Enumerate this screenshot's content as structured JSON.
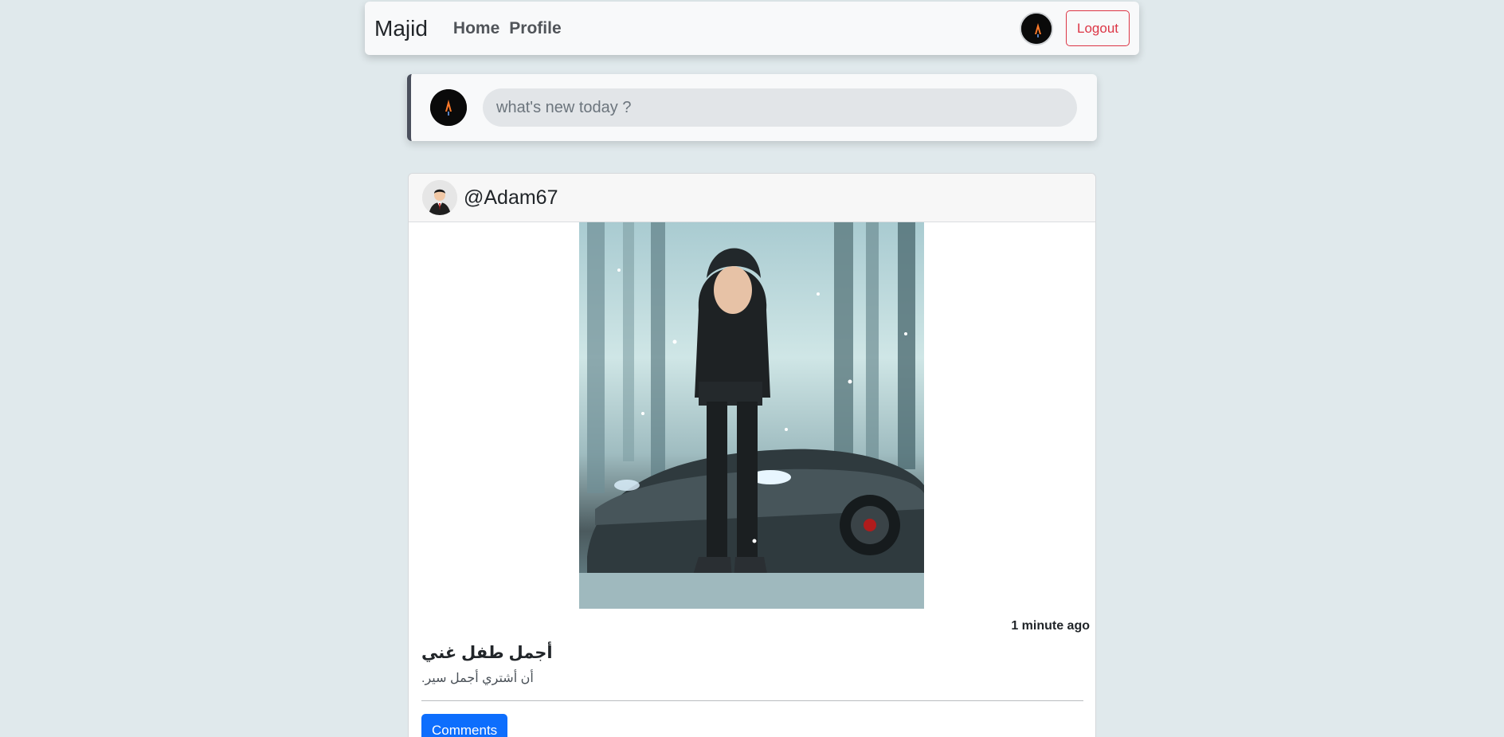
{
  "navbar": {
    "brand": "Majid",
    "links": [
      {
        "label": "Home"
      },
      {
        "label": "Profile"
      }
    ],
    "logout_label": "Logout"
  },
  "composer": {
    "placeholder": "what's new today ?"
  },
  "post": {
    "author": "@Adam67",
    "timestamp": "1 minute ago",
    "title": "أجمل طفل غني",
    "body": "أن أشتري أجمل سير.",
    "comments_label": "Comments"
  },
  "colors": {
    "page_background": "#e0e9ec",
    "logout_accent": "#dc3545",
    "primary_button": "#0d6efd"
  }
}
